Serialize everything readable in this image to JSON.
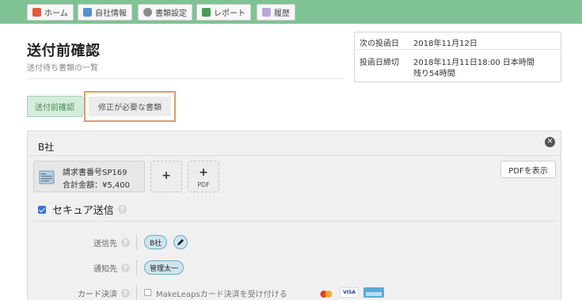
{
  "nav": {
    "tabs": [
      {
        "label": "ホーム",
        "icon": "home-icon"
      },
      {
        "label": "自社情報",
        "icon": "company-icon"
      },
      {
        "label": "書類設定",
        "icon": "settings-gear-icon"
      },
      {
        "label": "レポート",
        "icon": "report-chart-icon"
      },
      {
        "label": "履歴",
        "icon": "history-icon"
      }
    ]
  },
  "header": {
    "title": "送付前確認",
    "subtitle": "送付待ち書類の一覧"
  },
  "schedule": {
    "next_send_label": "次の投函日",
    "next_send_value": "2018年11月12日",
    "deadline_label": "投函日締切",
    "deadline_value": "2018年11月11日18:00 日本時間",
    "remaining": "残り54時間"
  },
  "steps": {
    "confirm": "送付前確認",
    "needs_fix": "修正が必要な書類"
  },
  "card": {
    "company": "B社",
    "document": {
      "number": "請求書番号SP169",
      "total": "合計金額：¥5,400"
    },
    "add_plus": "+",
    "add_pdf_label": "PDF",
    "pdf_button": "PDFを表示",
    "secure_label": "セキュア送信",
    "help_mark": "?",
    "fields": {
      "recipient_label": "送信先",
      "recipient_value": "B社",
      "notify_label": "通知先",
      "notify_value": "管理太一",
      "card_label": "カード決済",
      "card_option": "MakeLeapsカード決済を受け付ける"
    },
    "visa_text": "VISA"
  },
  "colors": {
    "topbar": "#7fc294",
    "accent_outline": "#e39a66",
    "checkbox": "#3b6fd8",
    "pill_border": "#6ea9c4",
    "pill_fill": "#cfe4ee"
  }
}
